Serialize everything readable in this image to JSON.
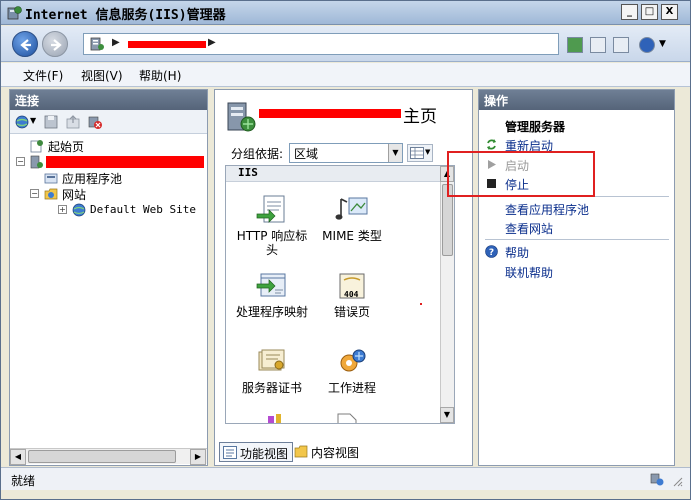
{
  "window": {
    "title": "Internet 信息服务(IIS)管理器",
    "buttons": {
      "minimize": "_",
      "maximize": "□",
      "close": "X"
    }
  },
  "navbar": {
    "address_separator": "▶",
    "address_redacted": true,
    "help_dropdown": "▼"
  },
  "menu": {
    "items": [
      "文件(F)",
      "视图(V)",
      "帮助(H)"
    ]
  },
  "connections": {
    "header": "连接",
    "tree": [
      {
        "label": "起始页",
        "icon": "start-page-icon"
      },
      {
        "label": "",
        "icon": "server-icon",
        "redacted": true
      },
      {
        "label": "应用程序池",
        "icon": "app-pool-icon"
      },
      {
        "label": "网站",
        "icon": "sites-folder-icon"
      },
      {
        "label": "Default Web Site",
        "icon": "globe-icon"
      }
    ]
  },
  "home": {
    "title_suffix": "主页",
    "groupby_label": "分组依据:",
    "groupby_value": "区域",
    "section": "IIS",
    "features": [
      {
        "label": "HTTP 响应标头",
        "icon": "http-headers-icon"
      },
      {
        "label": "MIME 类型",
        "icon": "mime-types-icon"
      },
      {
        "label": "处理程序映射",
        "icon": "handler-mappings-icon"
      },
      {
        "label": "错误页",
        "icon": "error-pages-icon",
        "badge": "404"
      },
      {
        "label": "服务器证书",
        "icon": "server-certificates-icon"
      },
      {
        "label": "工作进程",
        "icon": "worker-processes-icon"
      }
    ],
    "tabs": [
      {
        "label": "功能视图",
        "active": true
      },
      {
        "label": "内容视图",
        "active": false
      }
    ]
  },
  "actions": {
    "header": "操作",
    "manage_server": "管理服务器",
    "restart": "重新启动",
    "start": "启动",
    "stop": "停止",
    "view_app_pools": "查看应用程序池",
    "view_sites": "查看网站",
    "help": "帮助",
    "online_help": "联机帮助"
  },
  "status": {
    "text": "就绪"
  },
  "colors": {
    "redaction": "#ff0000",
    "highlight": "#e02020",
    "link": "#0a2e8c",
    "panel_header": "#5f6f85"
  }
}
